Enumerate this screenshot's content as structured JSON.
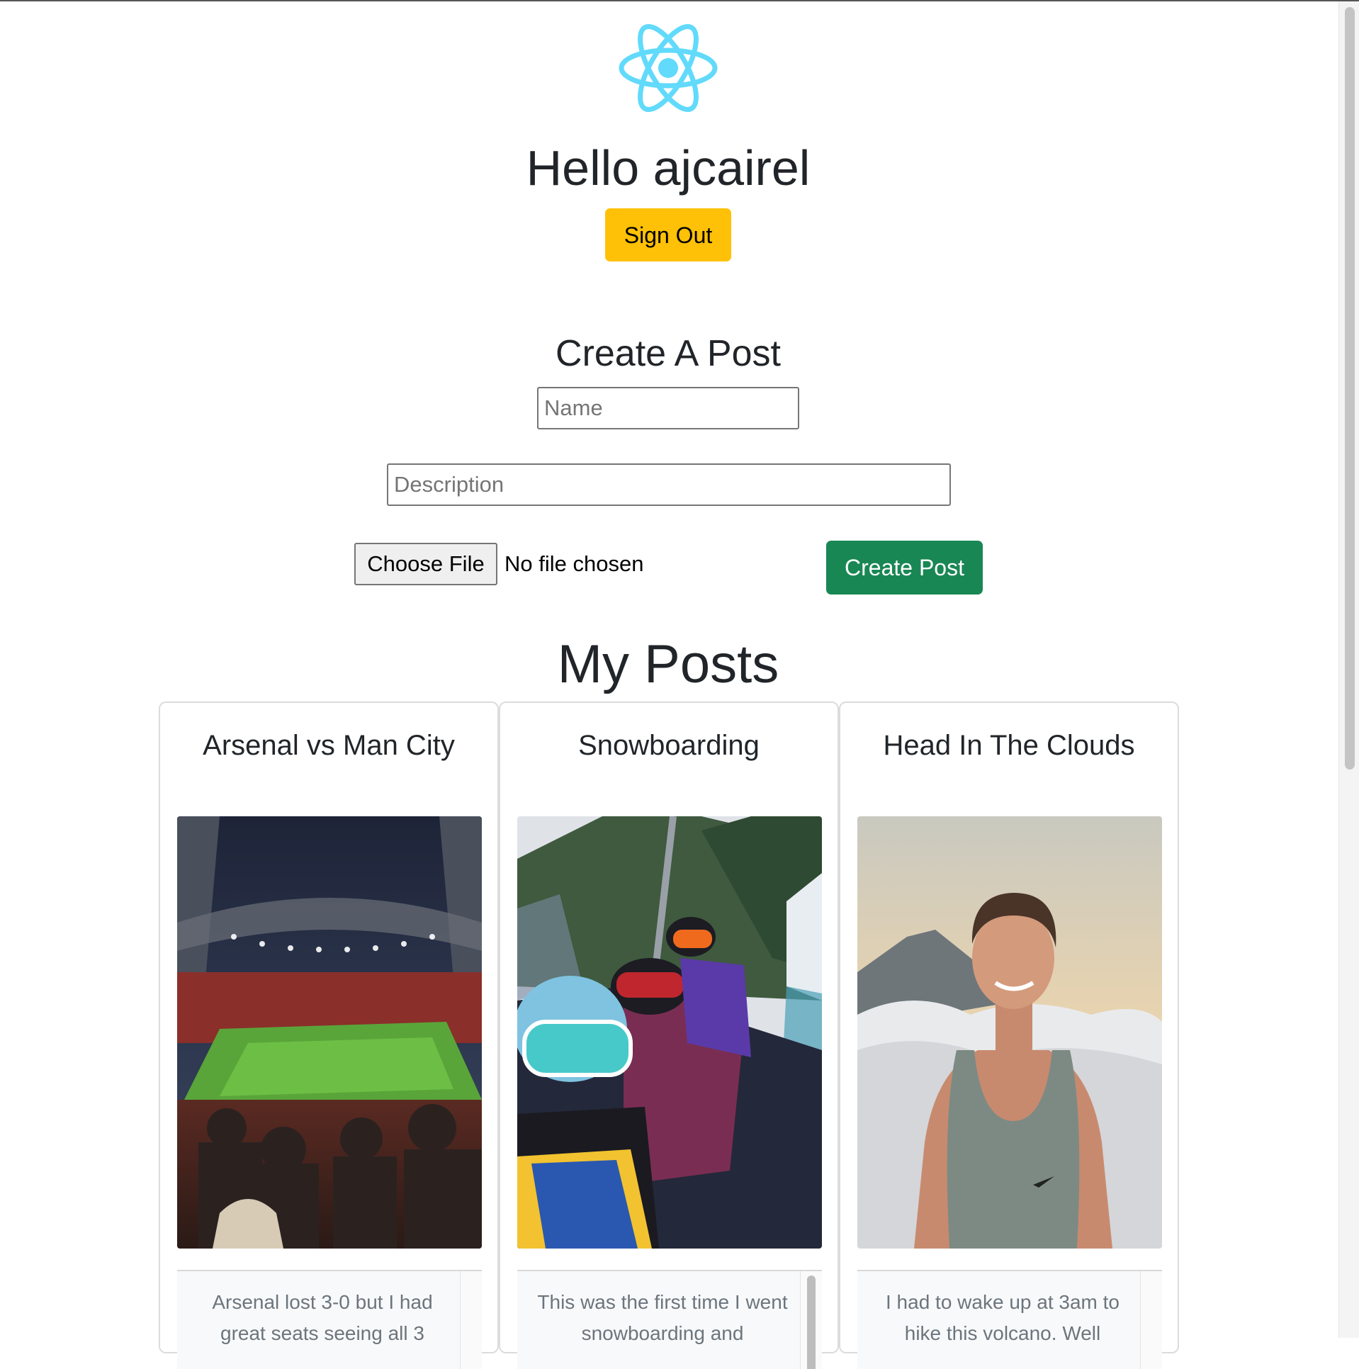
{
  "app": {
    "greeting": "Hello ajcairel",
    "sign_out_label": "Sign Out",
    "logo_icon": "react-logo-icon",
    "accent_colors": {
      "logo": "#61dafb",
      "sign_out": "#ffc107",
      "create": "#198754"
    }
  },
  "create_post": {
    "title": "Create A Post",
    "name_placeholder": "Name",
    "name_value": "",
    "description_placeholder": "Description",
    "description_value": "",
    "file_button_label": "Choose File",
    "file_status": "No file chosen",
    "submit_label": "Create Post"
  },
  "my_posts": {
    "title": "My Posts",
    "posts": [
      {
        "title": "Arsenal vs Man City",
        "image": "stadium-photo",
        "description": "Arsenal lost 3-0 but I had great seats seeing all 3"
      },
      {
        "title": "Snowboarding",
        "image": "ski-lift-photo",
        "description": "This was the first time I went snowboarding and"
      },
      {
        "title": "Head In The Clouds",
        "image": "volcano-portrait-photo",
        "description": "I had to wake up at 3am to hike this volcano. Well"
      }
    ]
  }
}
